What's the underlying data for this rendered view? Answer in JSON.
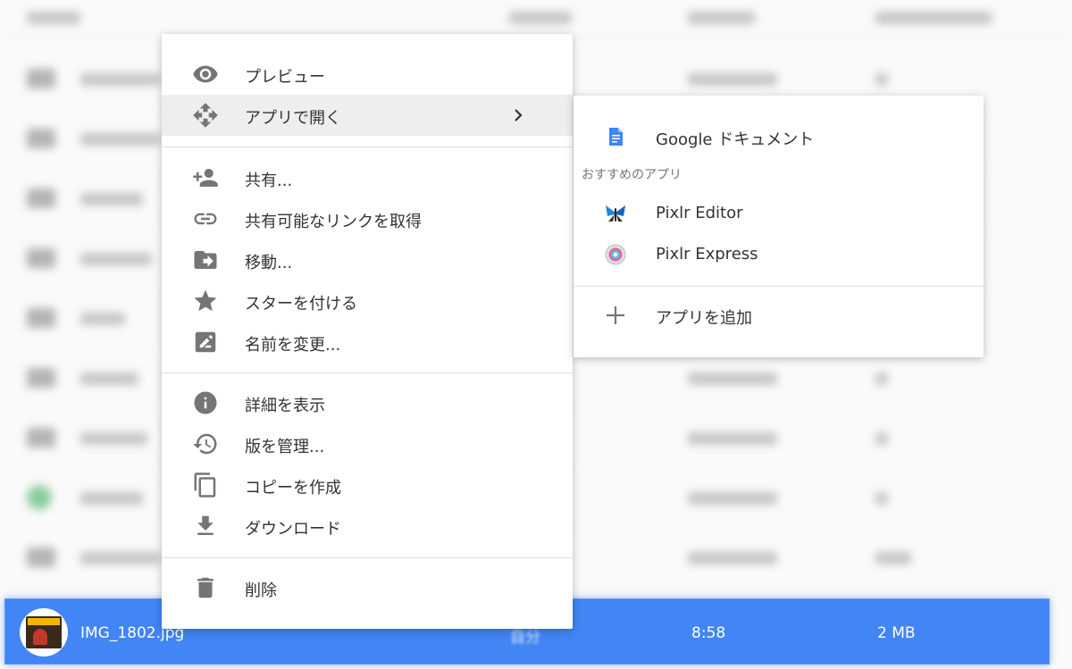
{
  "menu": {
    "items": [
      {
        "id": "preview",
        "label": "プレビュー"
      },
      {
        "id": "open-with",
        "label": "アプリで開く"
      },
      {
        "id": "share",
        "label": "共有..."
      },
      {
        "id": "get-link",
        "label": "共有可能なリンクを取得"
      },
      {
        "id": "move",
        "label": "移動..."
      },
      {
        "id": "star",
        "label": "スターを付ける"
      },
      {
        "id": "rename",
        "label": "名前を変更..."
      },
      {
        "id": "details",
        "label": "詳細を表示"
      },
      {
        "id": "versions",
        "label": "版を管理..."
      },
      {
        "id": "copy",
        "label": "コピーを作成"
      },
      {
        "id": "download",
        "label": "ダウンロード"
      },
      {
        "id": "delete",
        "label": "削除"
      }
    ]
  },
  "submenu": {
    "google_docs": "Google ドキュメント",
    "suggested_heading": "おすすめのアプリ",
    "pixlr_editor": "Pixlr Editor",
    "pixlr_express": "Pixlr Express",
    "add_app": "アプリを追加"
  },
  "selected_file": {
    "name": "IMG_1802.jpg",
    "owner": "自分",
    "modified": "8:58",
    "size": "2 MB"
  },
  "colors": {
    "selection": "#4285f4",
    "icon_gray": "#757575",
    "docs_blue": "#4285f4"
  },
  "icons": [
    "eye-icon",
    "move-arrows-icon",
    "chevron-right-icon",
    "person-add-icon",
    "link-icon",
    "folder-move-icon",
    "star-icon",
    "rename-icon",
    "info-icon",
    "history-icon",
    "copy-icon",
    "download-icon",
    "trash-icon",
    "google-docs-icon",
    "pixlr-editor-icon",
    "pixlr-express-icon",
    "plus-icon"
  ]
}
